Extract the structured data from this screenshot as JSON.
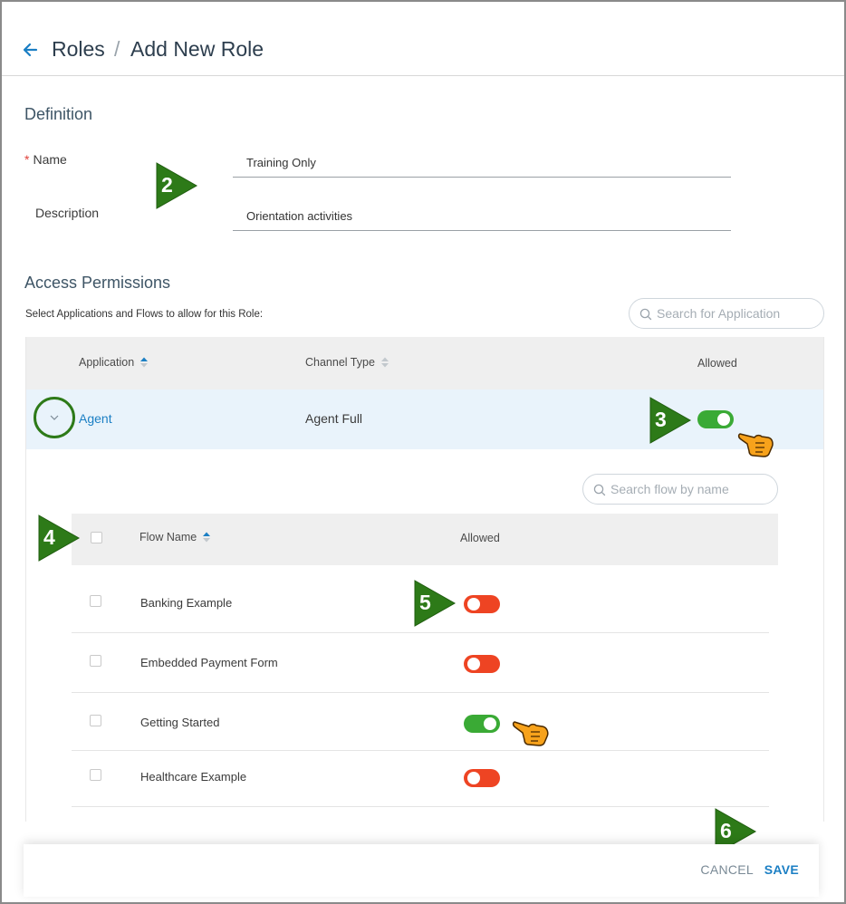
{
  "header": {
    "breadcrumb_parent": "Roles",
    "breadcrumb_separator": "/",
    "page_title": "Add New Role"
  },
  "definition": {
    "section_title": "Definition",
    "name_label": "Name",
    "name_value": "Training Only",
    "description_label": "Description",
    "description_value": "Orientation activities"
  },
  "access": {
    "section_title": "Access Permissions",
    "instructions": "Select Applications and Flows to allow for this Role:",
    "search_placeholder": "Search for Application",
    "columns": {
      "application": "Application",
      "channel_type": "Channel Type",
      "allowed": "Allowed"
    },
    "application_row": {
      "name": "Agent",
      "channel_type": "Agent Full",
      "allowed": true
    }
  },
  "flows": {
    "search_placeholder": "Search flow by name",
    "columns": {
      "flow_name": "Flow Name",
      "allowed": "Allowed"
    },
    "rows": [
      {
        "name": "Banking Example",
        "allowed": false
      },
      {
        "name": "Embedded Payment Form",
        "allowed": false
      },
      {
        "name": "Getting Started",
        "allowed": true
      },
      {
        "name": "Healthcare Example",
        "allowed": false
      }
    ]
  },
  "callouts": [
    "2",
    "3",
    "4",
    "5",
    "6"
  ],
  "footer": {
    "cancel_label": "CANCEL",
    "save_label": "SAVE"
  },
  "colors": {
    "toggle_on": "#3aaa35",
    "toggle_off": "#ee4423",
    "link_blue": "#1b7fc4",
    "callout_green": "#2d7a18"
  }
}
